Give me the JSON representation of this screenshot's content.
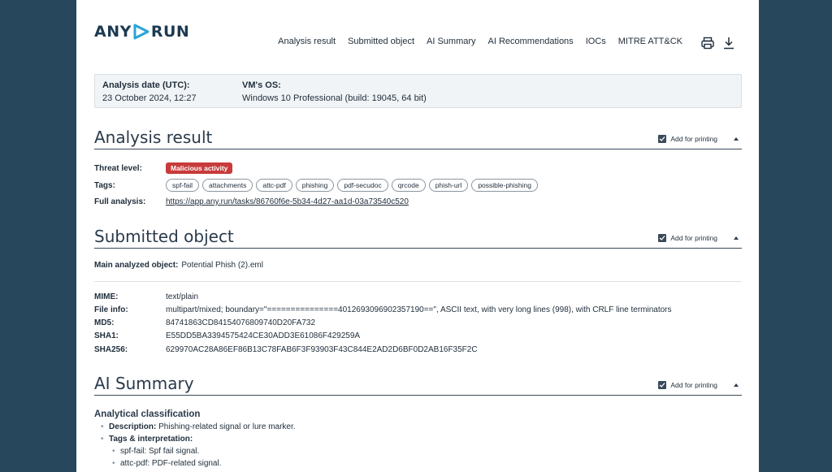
{
  "brand": {
    "left": "ANY",
    "right": "RUN"
  },
  "nav": [
    "Analysis result",
    "Submitted object",
    "AI Summary",
    "AI Recommendations",
    "IOCs",
    "MITRE ATT&CK"
  ],
  "info": {
    "date_label": "Analysis date (UTC):",
    "date_value": "23 October 2024, 12:27",
    "os_label": "VM's OS:",
    "os_value": "Windows 10 Professional (build: 19045, 64 bit)"
  },
  "print_label": "Add for printing",
  "analysis": {
    "title": "Analysis result",
    "threat_label": "Threat level:",
    "threat_value": "Malicious activity",
    "tags_label": "Tags:",
    "tags": [
      "spf-fail",
      "attachments",
      "attc-pdf",
      "phishing",
      "pdf-secudoc",
      "qrcode",
      "phish-url",
      "possible-phishing"
    ],
    "full_label": "Full analysis:",
    "full_url": "https://app.any.run/tasks/86760f6e-5b34-4d27-aa1d-03a73540c520"
  },
  "submitted": {
    "title": "Submitted object",
    "main_label": "Main analyzed object:",
    "main_value": "Potential Phish (2).eml",
    "mime_label": "MIME:",
    "mime_value": "text/plain",
    "fileinfo_label": "File info:",
    "fileinfo_value": "multipart/mixed; boundary=\"===============4012693096902357190==\", ASCII text, with very long lines (998), with CRLF line terminators",
    "md5_label": "MD5:",
    "md5_value": "84741863CD84154076809740D20FA732",
    "sha1_label": "SHA1:",
    "sha1_value": "E55DD5BA3394575424CE30ADD3E61086F429259A",
    "sha256_label": "SHA256:",
    "sha256_value": "629970AC28A86EF86B13C78FAB6F3F93903F43C844E2AD2D6BF0D2AB16F35F2C"
  },
  "ai": {
    "title": "AI Summary",
    "heading": "Analytical classification",
    "desc_label": "Description:",
    "desc_value": "Phishing-related signal or lure marker.",
    "tags_label": "Tags & interpretation:",
    "items": [
      "spf-fail: Spf fail signal.",
      "attc-pdf: PDF-related signal."
    ]
  }
}
